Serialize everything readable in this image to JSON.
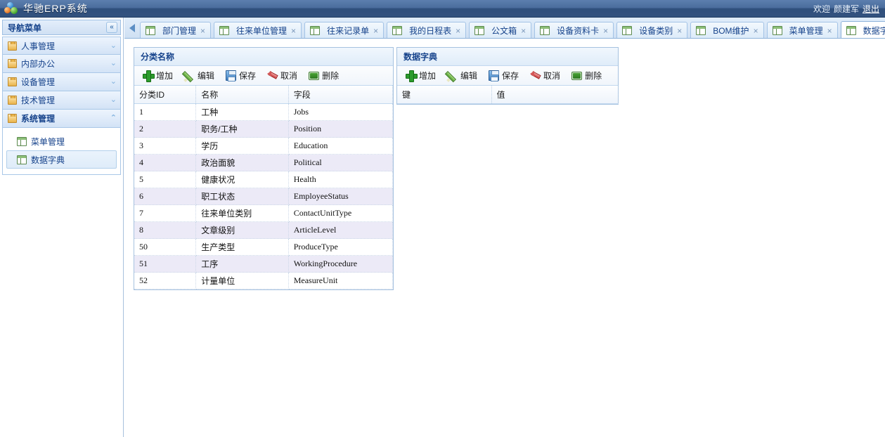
{
  "header": {
    "logo_icon": "three-spheres-logo",
    "title": "华驰ERP系统",
    "greeting": "欢迎",
    "user": "颜建军",
    "logout": "退出"
  },
  "sidebar": {
    "title": "导航菜单",
    "collapse_icon": "«",
    "groups": [
      {
        "label": "人事管理",
        "icon": "folder-icon",
        "chevron": "⌄",
        "expanded": false
      },
      {
        "label": "内部办公",
        "icon": "folder-icon",
        "chevron": "⌄",
        "expanded": false
      },
      {
        "label": "设备管理",
        "icon": "folder-icon",
        "chevron": "⌄",
        "expanded": false
      },
      {
        "label": "技术管理",
        "icon": "folder-icon",
        "chevron": "⌄",
        "expanded": false
      },
      {
        "label": "系统管理",
        "icon": "folder-icon",
        "chevron": "⌃",
        "expanded": true
      }
    ],
    "sub_items": [
      {
        "label": "菜单管理",
        "icon": "grid-icon",
        "selected": false
      },
      {
        "label": "数据字典",
        "icon": "grid-icon",
        "selected": true
      }
    ]
  },
  "tabbar": {
    "scroll_left_icon": "triangle-left-icon",
    "tabs": [
      {
        "label": "部门管理",
        "icon": "grid-icon",
        "close": "×",
        "active": false
      },
      {
        "label": "往来单位管理",
        "icon": "grid-icon",
        "close": "×",
        "active": false
      },
      {
        "label": "往来记录单",
        "icon": "grid-icon",
        "close": "×",
        "active": false
      },
      {
        "label": "我的日程表",
        "icon": "grid-icon",
        "close": "×",
        "active": false
      },
      {
        "label": "公文箱",
        "icon": "grid-icon",
        "close": "×",
        "active": false
      },
      {
        "label": "设备资料卡",
        "icon": "grid-icon",
        "close": "×",
        "active": false
      },
      {
        "label": "设备类别",
        "icon": "grid-icon",
        "close": "×",
        "active": false
      },
      {
        "label": "BOM维护",
        "icon": "grid-icon",
        "close": "×",
        "active": false
      },
      {
        "label": "菜单管理",
        "icon": "grid-icon",
        "close": "×",
        "active": false
      },
      {
        "label": "数据字典",
        "icon": "grid-icon",
        "close": "×",
        "active": true
      }
    ]
  },
  "toolbar_labels": {
    "add": "增加",
    "edit": "编辑",
    "save": "保存",
    "cancel": "取消",
    "delete": "删除"
  },
  "panel_left": {
    "title": "分类名称",
    "columns": [
      "分类ID",
      "名称",
      "字段"
    ],
    "rows": [
      {
        "id": "1",
        "name": "工种",
        "field": "Jobs"
      },
      {
        "id": "2",
        "name": "职务/工种",
        "field": "Position"
      },
      {
        "id": "3",
        "name": "学历",
        "field": "Education"
      },
      {
        "id": "4",
        "name": "政治面貌",
        "field": "Political"
      },
      {
        "id": "5",
        "name": "健康状况",
        "field": "Health"
      },
      {
        "id": "6",
        "name": "职工状态",
        "field": "EmployeeStatus"
      },
      {
        "id": "7",
        "name": "往来单位类别",
        "field": "ContactUnitType"
      },
      {
        "id": "8",
        "name": "文章级别",
        "field": "ArticleLevel"
      },
      {
        "id": "50",
        "name": "生产类型",
        "field": "ProduceType"
      },
      {
        "id": "51",
        "name": "工序",
        "field": "WorkingProcedure"
      },
      {
        "id": "52",
        "name": "计量单位",
        "field": "MeasureUnit"
      }
    ]
  },
  "panel_right": {
    "title": "数据字典",
    "columns": [
      "键",
      "值"
    ],
    "rows": []
  },
  "colors": {
    "header_top": "#5c7fae",
    "header_bottom": "#2f4f7c",
    "accent_text": "#15428b",
    "panel_border": "#a6c2e0",
    "row_alt": "#eceaf7"
  }
}
